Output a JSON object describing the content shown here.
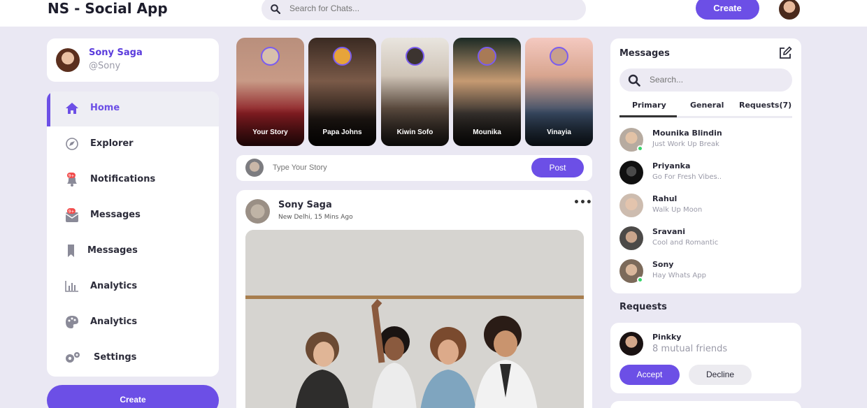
{
  "app": {
    "title": "NS - Social App"
  },
  "header": {
    "search_placeholder": "Search for Chats...",
    "create_label": "Create"
  },
  "profile": {
    "name": "Sony Saga",
    "handle": "@Sony"
  },
  "sidebar": {
    "items": [
      {
        "label": "Home",
        "icon": "home-icon",
        "active": true
      },
      {
        "label": "Explorer",
        "icon": "compass-icon",
        "active": false
      },
      {
        "label": "Notifications",
        "icon": "bell-icon",
        "badge": "9+",
        "active": false
      },
      {
        "label": "Messages",
        "icon": "envelope-icon",
        "badge": "9+",
        "active": false
      },
      {
        "label": "Messages",
        "icon": "bookmark-icon",
        "active": false
      },
      {
        "label": "Analytics",
        "icon": "bar-chart-icon",
        "active": false
      },
      {
        "label": "Analytics",
        "icon": "palette-icon",
        "active": false
      },
      {
        "label": "Settings",
        "icon": "gears-icon",
        "active": false
      }
    ],
    "create_label": "Create"
  },
  "stories": [
    {
      "caption": "Your Story"
    },
    {
      "caption": "Papa Johns"
    },
    {
      "caption": "Kiwin Sofo"
    },
    {
      "caption": "Mounika"
    },
    {
      "caption": "Vinayia"
    }
  ],
  "story_input": {
    "placeholder": "Type Your Story",
    "post_label": "Post"
  },
  "post": {
    "author": "Sony Saga",
    "meta": "New Delhi, 15 Mins Ago",
    "more": "•••"
  },
  "messages": {
    "title": "Messages",
    "search_placeholder": "Search...",
    "tabs": [
      "Primary",
      "General",
      "Requests(7)"
    ],
    "chats": [
      {
        "name": "Mounika Blindin",
        "text": "Just Work Up Break",
        "online": true
      },
      {
        "name": "Priyanka",
        "text": "Go For Fresh Vibes..",
        "online": false
      },
      {
        "name": "Rahul",
        "text": "Walk Up Moon",
        "online": false
      },
      {
        "name": "Sravani",
        "text": "Cool and Romantic",
        "online": false
      },
      {
        "name": "Sony",
        "text": "Hay Whats App",
        "online": true
      }
    ]
  },
  "requests": {
    "heading": "Requests",
    "items": [
      {
        "name": "Pinkky",
        "mutual": "8 mutual friends",
        "accept_label": "Accept",
        "decline_label": "Decline"
      }
    ]
  },
  "colors": {
    "accent": "#6c4fe6",
    "background": "#eae8f3",
    "online": "#36d46a"
  }
}
